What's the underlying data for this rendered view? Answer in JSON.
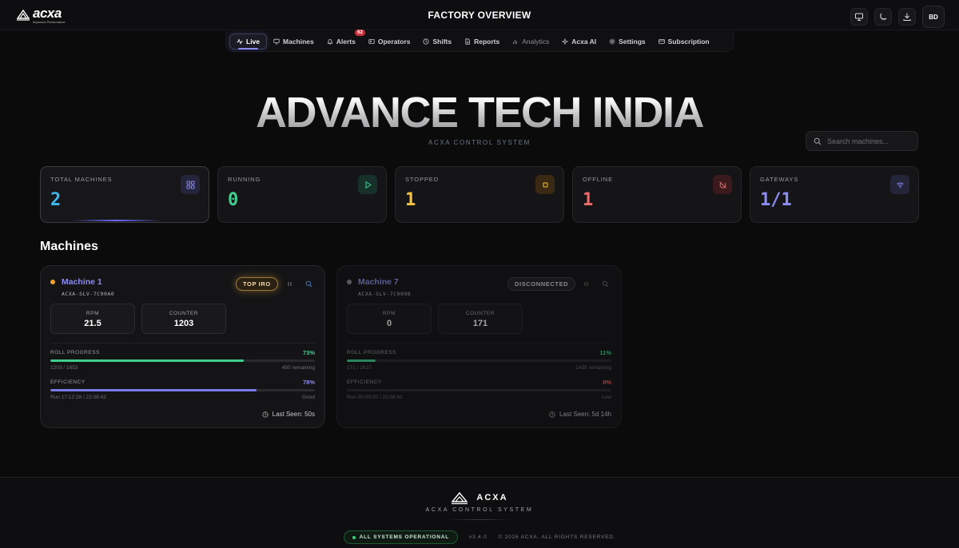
{
  "brand": {
    "logo_word": "acxa",
    "logo_tagline": "Improves Performance"
  },
  "header": {
    "title": "FACTORY OVERVIEW",
    "avatar_initials": "BD"
  },
  "nav": {
    "items": [
      {
        "label": "Live",
        "icon": "pulse-icon"
      },
      {
        "label": "Machines",
        "icon": "monitor-icon"
      },
      {
        "label": "Alerts",
        "icon": "bell-icon",
        "badge": "62"
      },
      {
        "label": "Operators",
        "icon": "id-card-icon"
      },
      {
        "label": "Shifts",
        "icon": "clock-icon"
      },
      {
        "label": "Reports",
        "icon": "file-icon"
      },
      {
        "label": "Analytics",
        "icon": "bar-chart-icon"
      },
      {
        "label": "Acxa AI",
        "icon": "sparkle-icon"
      },
      {
        "label": "Settings",
        "icon": "gear-icon"
      },
      {
        "label": "Subscription",
        "icon": "card-icon"
      }
    ]
  },
  "hero": {
    "title": "ADVANCE TECH INDIA",
    "subtitle": "ACXA CONTROL SYSTEM"
  },
  "search": {
    "placeholder": "Search machines..."
  },
  "stats": [
    {
      "label": "TOTAL MACHINES",
      "value": "2",
      "color": "#3fb8f0",
      "icon": "grid-icon"
    },
    {
      "label": "RUNNING",
      "value": "0",
      "color": "#3ecf8e",
      "icon": "play-icon"
    },
    {
      "label": "STOPPED",
      "value": "1",
      "color": "#f5c242",
      "icon": "stop-icon"
    },
    {
      "label": "OFFLINE",
      "value": "1",
      "color": "#f06a6a",
      "icon": "power-off-icon"
    },
    {
      "label": "GATEWAYS",
      "value": "1/1",
      "color": "#8c8cf5",
      "icon": "wifi-icon"
    }
  ],
  "machines_title": "Machines",
  "machines": [
    {
      "name": "Machine 1",
      "id": "ACXA-SLV-7C90A0",
      "status_pill": "TOP IRO",
      "rpm_label": "RPM",
      "rpm": "21.5",
      "counter_label": "COUNTER",
      "counter": "1203",
      "roll_label": "ROLL PROGRESS",
      "roll_pct": "73%",
      "roll_value": 0.73,
      "roll_count": "1203 / 1653",
      "roll_remaining": "450 remaining",
      "eff_label": "EFFICIENCY",
      "eff_pct": "78%",
      "eff_value": 0.78,
      "run_time": "Run 17:12:28 / 22:08:42",
      "eff_rating": "Good",
      "last_seen": "Last Seen: 50s"
    },
    {
      "name": "Machine 7",
      "id": "ACXA-SLV-7C9098",
      "status_pill": "DISCONNECTED",
      "rpm_label": "RPM",
      "rpm": "0",
      "counter_label": "COUNTER",
      "counter": "171",
      "roll_label": "ROLL PROGRESS",
      "roll_pct": "11%",
      "roll_value": 0.11,
      "roll_count": "171 / 1610",
      "roll_remaining": "1439 remaining",
      "eff_label": "EFFICIENCY",
      "eff_pct": "0%",
      "eff_value": 0,
      "run_time": "Run 00:00:00 / 22:08:42",
      "eff_rating": "Low",
      "last_seen": "Last Seen: 5d 14h"
    }
  ],
  "footer": {
    "name": "ACXA",
    "subtitle": "ACXA CONTROL SYSTEM",
    "status": "ALL SYSTEMS OPERATIONAL",
    "version": "v3.4.0",
    "copyright": "© 2026 ACXA. ALL RIGHTS RESERVED."
  },
  "colors": {
    "accent": "#8b8bf0",
    "roll_fill": "#3ecf8e",
    "eff_fill": "#7b7be8",
    "machine1_dot": "#f0a030",
    "machine7_dot": "#8a8a90"
  }
}
